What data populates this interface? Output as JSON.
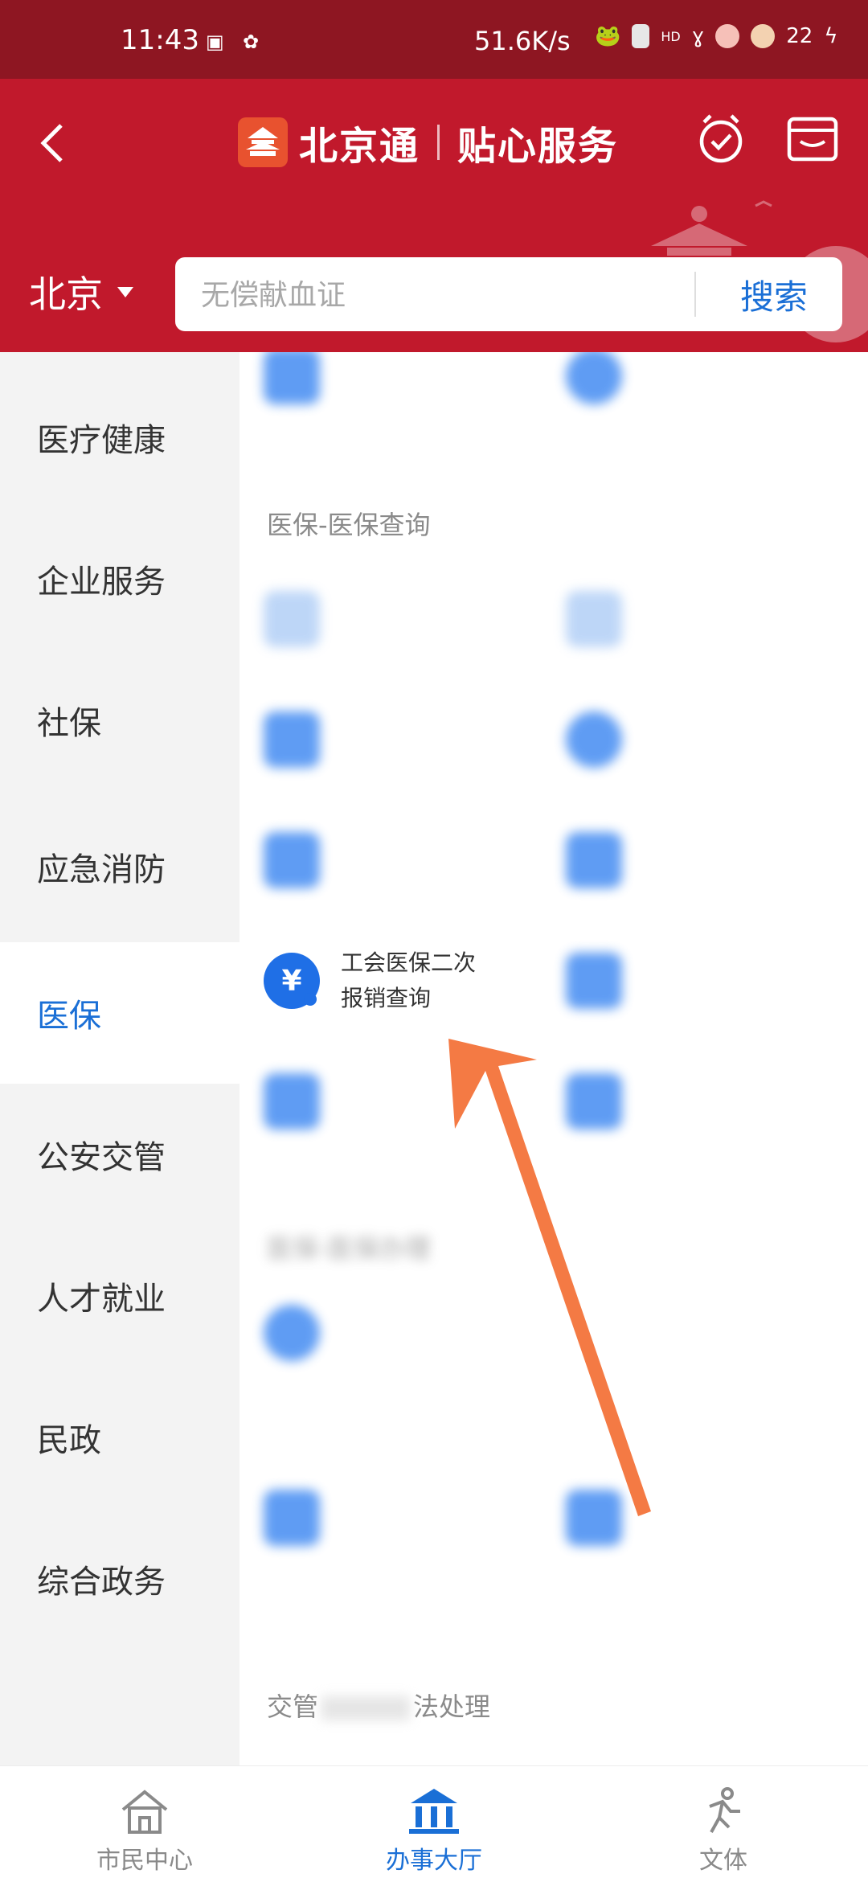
{
  "status_bar": {
    "time": "11:43",
    "net_speed": "51.6K/s",
    "hd_label": "HD",
    "battery": "22"
  },
  "header": {
    "app_name": "北京通",
    "sub_title": "贴心服务",
    "city": "北京",
    "search": {
      "placeholder": "无偿献血证",
      "button_label": "搜索"
    },
    "colors": {
      "status_bar": "#8e1622",
      "header": "#c1192c"
    }
  },
  "sidebar": {
    "items": [
      {
        "label": "医疗健康"
      },
      {
        "label": "企业服务"
      },
      {
        "label": "社保"
      },
      {
        "label": "应急消防"
      },
      {
        "label": "医保",
        "active": true
      },
      {
        "label": "公安交管"
      },
      {
        "label": "人才就业"
      },
      {
        "label": "民政"
      },
      {
        "label": "综合政务"
      }
    ],
    "active_color": "#1a6fd6"
  },
  "content": {
    "sections": [
      {
        "title": "医保-医保查询"
      },
      {
        "title": "医保-医保办理"
      },
      {
        "title": "交管"
      },
      {
        "title": "法处理"
      }
    ],
    "highlighted_service": {
      "label_line1": "工会医保二次",
      "label_line2": "报销查询",
      "icon": "yuan-search-icon"
    }
  },
  "bottom_nav": {
    "items": [
      {
        "label": "市民中心",
        "icon": "home-icon"
      },
      {
        "label": "办事大厅",
        "icon": "bank-building-icon",
        "active": true
      },
      {
        "label": "文体",
        "icon": "runner-icon"
      }
    ]
  }
}
